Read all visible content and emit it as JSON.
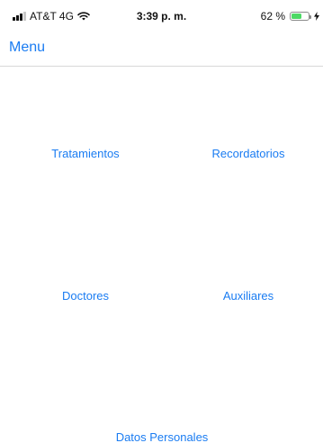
{
  "status_bar": {
    "carrier": "AT&T 4G",
    "time": "3:39 p. m.",
    "battery_percent": "62 %",
    "battery_level": 0.62,
    "icons": [
      "signal-icon",
      "wifi-icon",
      "battery-icon",
      "bolt-icon"
    ]
  },
  "nav": {
    "title": "Menu"
  },
  "menu": {
    "items": [
      {
        "label": "Tratamientos"
      },
      {
        "label": "Recordatorios"
      },
      {
        "label": "Doctores"
      },
      {
        "label": "Auxiliares"
      },
      {
        "label": "Datos Personales"
      }
    ]
  },
  "colors": {
    "accent": "#1a7cf2",
    "battery_fill": "#4cd964",
    "divider": "#d8d8d8"
  }
}
